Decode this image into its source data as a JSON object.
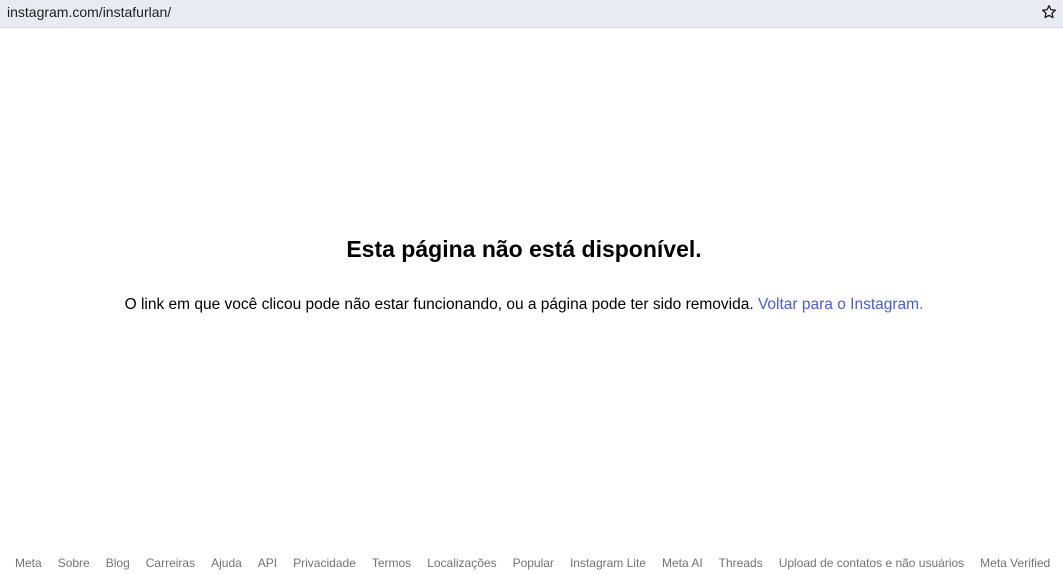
{
  "browser": {
    "url": "instagram.com/instafurlan/",
    "bookmark_icon": "star-icon"
  },
  "main": {
    "title": "Esta página não está disponível.",
    "message": "O link em que você clicou pode não estar funcionando, ou a página pode ter sido removida.",
    "link_label": "Voltar para o Instagram.",
    "link_color": "#4a5bd5"
  },
  "footer": {
    "links": [
      "Meta",
      "Sobre",
      "Blog",
      "Carreiras",
      "Ajuda",
      "API",
      "Privacidade",
      "Termos",
      "Localizações",
      "Popular",
      "Instagram Lite",
      "Meta AI",
      "Threads",
      "Upload de contatos e não usuários",
      "Meta Verified"
    ],
    "text_color": "#737373"
  }
}
